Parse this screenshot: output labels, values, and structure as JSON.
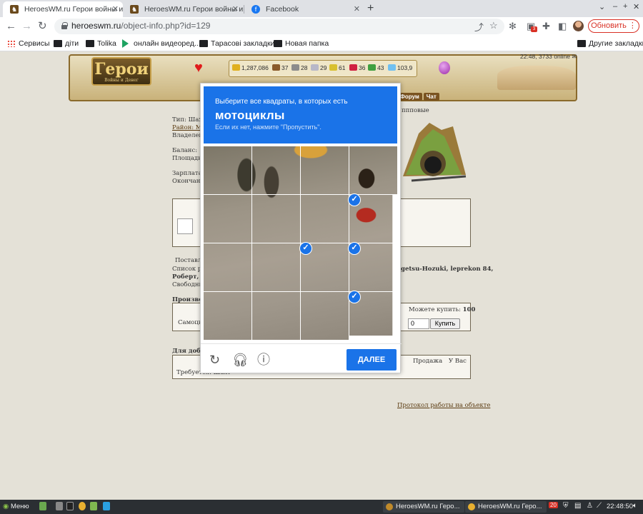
{
  "browser": {
    "tabs": [
      {
        "title": "HeroesWM.ru Герои войны и ...",
        "active": true
      },
      {
        "title": "HeroesWM.ru Герои войны и ...",
        "active": false
      },
      {
        "title": "Facebook",
        "active": false
      }
    ],
    "url_host": "heroeswm.ru",
    "url_path": "/object-info.php?id=129",
    "update_button": "Обновить",
    "extension_badge": "3",
    "bookmarks": [
      "Сервисы",
      "діти",
      "Tolika",
      "онлайн видеоред...",
      "Тарасові закладки",
      "Новая папка"
    ],
    "other_bookmarks": "Другие закладки"
  },
  "game": {
    "logo_text": "Герои",
    "logo_subtext": "Войны и Денег",
    "resources": [
      "1,287,086",
      "37",
      "28",
      "29",
      "61",
      "36",
      "43",
      "103,9"
    ],
    "clock": "22:48, 3733 online",
    "nav_tabs": [
      "Форум",
      "Чат"
    ],
    "info_lines": [
      "Тип: Шахт",
      "Район: Mi",
      "Владелец:",
      "Баланс:",
      "Площадь:",
      "Зарплата:",
      "Окончани"
    ],
    "info_tail": "ппповые",
    "supply_label": "Поставл",
    "workers_label": "Список ра",
    "workers_bold": "Роберт, П",
    "workers_right": "getsu-Hozuki, leprekon 84,",
    "free_label": "Свободны",
    "production_label": "Производ",
    "can_buy_label": "Можете купить:",
    "can_buy_value": "100",
    "self_label": "Самоцв",
    "quantity": "0",
    "buy_button": "Купить",
    "mining_label": "Для добы",
    "sale_header": "Продажа",
    "have_header": "У Вас",
    "requires_label": "Требуется: Шахт",
    "protocol_link": "Протокол работы на объекте"
  },
  "captcha": {
    "instruction": "Выберите все квадраты, в которых есть",
    "target": "мотоциклы",
    "hint": "Если их нет, нажмите \"Пропустить\".",
    "next_button": "ДАЛЕЕ",
    "selected_tiles": [
      7,
      10,
      11,
      15
    ],
    "accent": "#1a73e8"
  },
  "taskbar": {
    "menu_label": "Меню",
    "windows": [
      "HeroesWM.ru Геро...",
      "HeroesWM.ru Геро..."
    ],
    "tray_badge": "20",
    "clock": "22:48:50"
  }
}
